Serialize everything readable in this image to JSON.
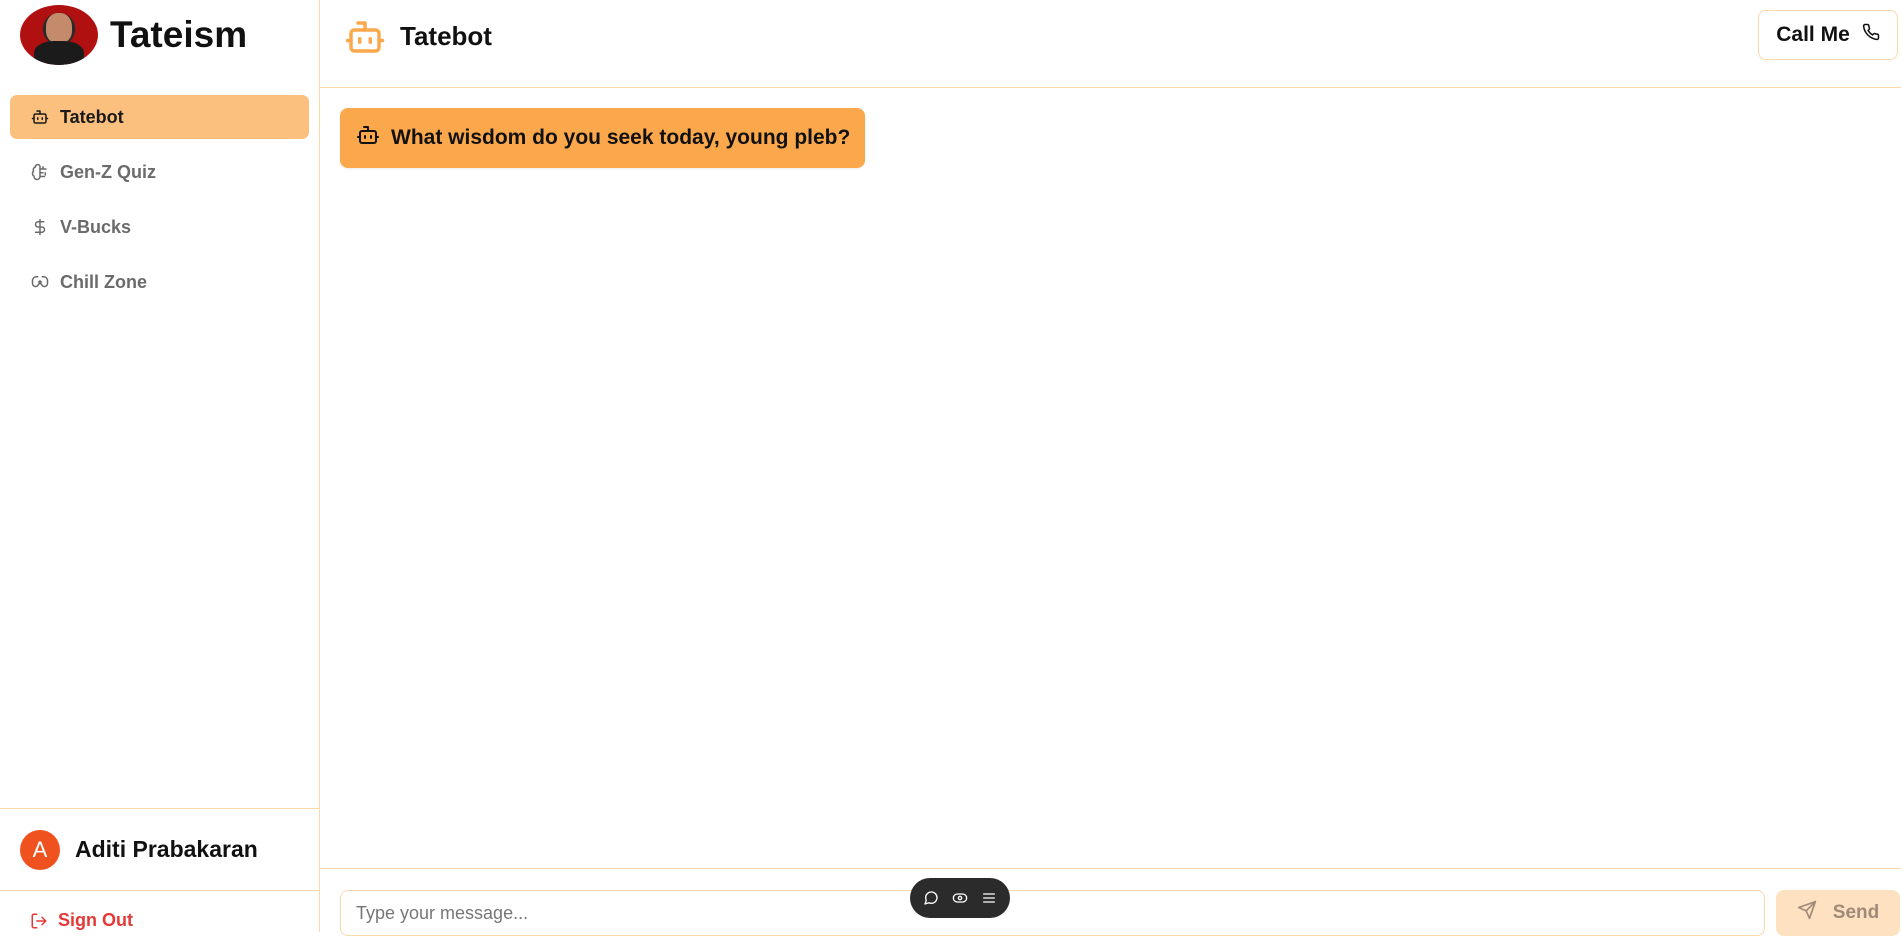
{
  "app": {
    "brand_name": "Tateism"
  },
  "sidebar": {
    "items": [
      {
        "label": "Tatebot",
        "icon": "bot-icon",
        "active": true
      },
      {
        "label": "Gen-Z Quiz",
        "icon": "brain-icon",
        "active": false
      },
      {
        "label": "V-Bucks",
        "icon": "dollar-icon",
        "active": false
      },
      {
        "label": "Chill Zone",
        "icon": "gamepad-icon",
        "active": false
      }
    ],
    "user": {
      "initial": "A",
      "name": "Aditi Prabakaran"
    },
    "sign_out_label": "Sign Out"
  },
  "header": {
    "title": "Tatebot",
    "call_label": "Call Me"
  },
  "chat": {
    "messages": [
      {
        "sender": "bot",
        "text": "What wisdom do you seek today, young pleb?"
      }
    ]
  },
  "composer": {
    "placeholder": "Type your message...",
    "send_label": "Send"
  },
  "colors": {
    "accent": "#fba84c",
    "active_nav": "#fbc07e",
    "border": "#fbd9a8",
    "sign_out": "#e53935",
    "user_avatar": "#f0521f",
    "send_disabled": "#fde1c1"
  }
}
